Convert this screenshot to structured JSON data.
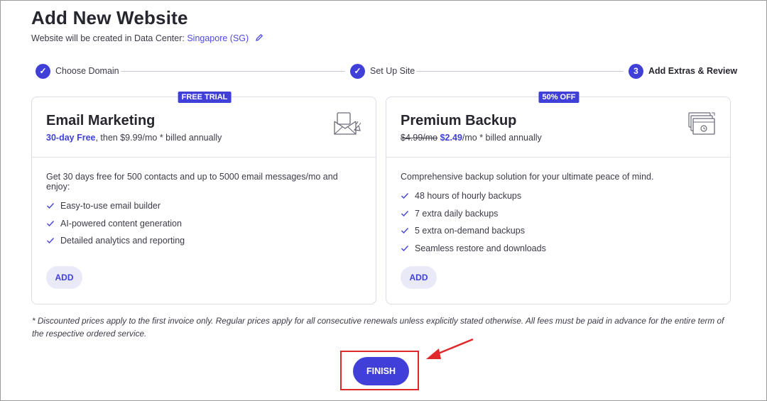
{
  "header": {
    "title": "Add New Website",
    "subtitle_prefix": "Website will be created in Data Center: ",
    "data_center": "Singapore (SG)"
  },
  "stepper": {
    "steps": [
      {
        "label": "Choose Domain",
        "state": "complete",
        "marker": "✓"
      },
      {
        "label": "Set Up Site",
        "state": "complete",
        "marker": "✓"
      },
      {
        "label": "Add Extras & Review",
        "state": "active",
        "marker": "3"
      }
    ]
  },
  "cards": [
    {
      "badge": "FREE TRIAL",
      "title": "Email Marketing",
      "price_highlight": "30-day Free",
      "price_rest": ", then $9.99/mo * billed annually",
      "icon": "email-envelope-icon",
      "description": "Get 30 days free for 500 contacts and up to 5000 email messages/mo and enjoy:",
      "features": [
        "Easy-to-use email builder",
        "AI-powered content generation",
        "Detailed analytics and reporting"
      ],
      "add_label": "ADD"
    },
    {
      "badge": "50% OFF",
      "title": "Premium Backup",
      "price_old": "$4.99/mo",
      "price_new": "$2.49",
      "price_rest": "/mo * billed annually",
      "icon": "backup-windows-icon",
      "description": "Comprehensive backup solution for your ultimate peace of mind.",
      "features": [
        "48 hours of hourly backups",
        "7 extra daily backups",
        "5 extra on-demand backups",
        "Seamless restore and downloads"
      ],
      "add_label": "ADD"
    }
  ],
  "disclaimer": "* Discounted prices apply to the first invoice only. Regular prices apply for all consecutive renewals unless explicitly stated otherwise. All fees must be paid in advance for the entire term of the respective ordered service.",
  "finish_label": "FINISH",
  "colors": {
    "accent": "#4040d8",
    "annotation": "#e0282a",
    "add_button_bg": "#e9e9f8"
  }
}
